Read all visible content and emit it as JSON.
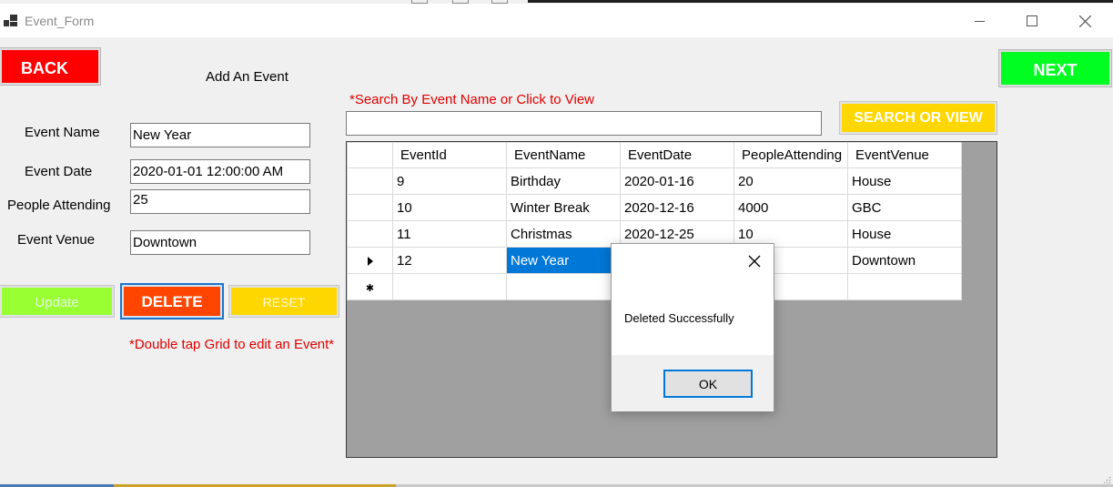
{
  "window": {
    "title": "Event_Form",
    "icons": [
      "app-icon",
      "minimize-icon",
      "maximize-icon",
      "close-icon"
    ]
  },
  "nav": {
    "back_label": "BACK",
    "next_label": "NEXT"
  },
  "form": {
    "heading": "Add An Event",
    "event_name_label": "Event Name",
    "event_name_value": "New Year",
    "event_date_label": "Event Date",
    "event_date_value": "2020-01-01 12:00:00 AM",
    "people_label": "People Attending",
    "people_value": "25",
    "venue_label": "Event Venue",
    "venue_value": "Downtown"
  },
  "actions": {
    "update_label": "Update",
    "delete_label": "DELETE",
    "reset_label": "RESET"
  },
  "hints": {
    "search_hint": "*Search By Event Name or Click to View",
    "edit_hint": "*Double tap Grid to edit an Event*"
  },
  "search": {
    "value": "",
    "button_label": "SEARCH OR VIEW"
  },
  "grid": {
    "columns": [
      "EventId",
      "EventName",
      "EventDate",
      "PeopleAttending",
      "EventVenue"
    ],
    "rows": [
      [
        "9",
        "Birthday",
        "2020-01-16",
        "20",
        "House"
      ],
      [
        "10",
        "Winter Break",
        "2020-12-16",
        "4000",
        "GBC"
      ],
      [
        "11",
        "Christmas",
        "2020-12-25",
        "10",
        "House"
      ],
      [
        "12",
        "New Year",
        "",
        "",
        "Downtown"
      ]
    ],
    "current_row_marker": "row-pointer-icon",
    "new_row_marker": "new-row-icon"
  },
  "dialog": {
    "message": "Deleted Successfully",
    "ok_label": "OK"
  },
  "colors": {
    "back": "#ff0000",
    "next": "#00ff21",
    "update": "#99ff33",
    "delete": "#ff4500",
    "reset": "#ffd700",
    "search": "#ffd700",
    "hint": "#e00000",
    "selection": "#0078d7"
  }
}
